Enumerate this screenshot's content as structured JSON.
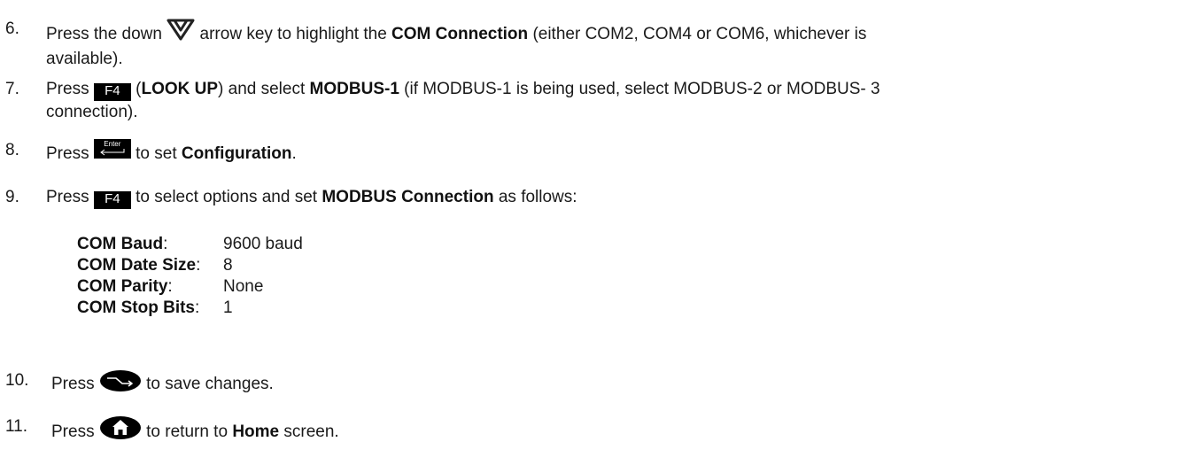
{
  "steps": [
    {
      "number": "6.",
      "text_a": "Press the down",
      "text_b": "arrow key to highlight the",
      "bold_a": "COM Connection",
      "text_c": "(either COM2, COM4 or COM6, whichever is",
      "text_d": "available)."
    },
    {
      "number": "7.",
      "text_a": "Press",
      "key_label": "F4",
      "text_b": "(",
      "bold_a": "LOOK UP",
      "text_c": ") and select",
      "bold_b": "MODBUS-1",
      "text_d": "(if MODBUS-1 is being used, select MODBUS-2 or MODBUS- 3",
      "text_e": "connection)."
    },
    {
      "number": "8.",
      "text_a": "Press",
      "key_label": "Enter",
      "text_b": "to set",
      "bold_a": "Configuration",
      "text_c": "."
    },
    {
      "number": "9.",
      "text_a": "Press",
      "key_label": "F4",
      "text_b": "to select options and set",
      "bold_a": "MODBUS Connection",
      "text_c": "as follows:"
    },
    {
      "number": "10.",
      "text_a": "Press",
      "text_b": "to save changes."
    },
    {
      "number": "11.",
      "text_a": "Press",
      "text_b": "to return to",
      "bold_a": "Home",
      "text_c": "screen."
    }
  ],
  "settings": [
    {
      "label": "COM Baud",
      "colon": ":",
      "value": "9600 baud"
    },
    {
      "label": "COM Date Size",
      "colon": ":",
      "value": "8"
    },
    {
      "label": "COM Parity",
      "colon": ":",
      "value": "None"
    },
    {
      "label": "COM Stop Bits",
      "colon": ":",
      "value": "1"
    }
  ],
  "icons": {
    "down_arrow": "down-arrow-icon",
    "save": "save-icon",
    "home": "home-icon"
  }
}
